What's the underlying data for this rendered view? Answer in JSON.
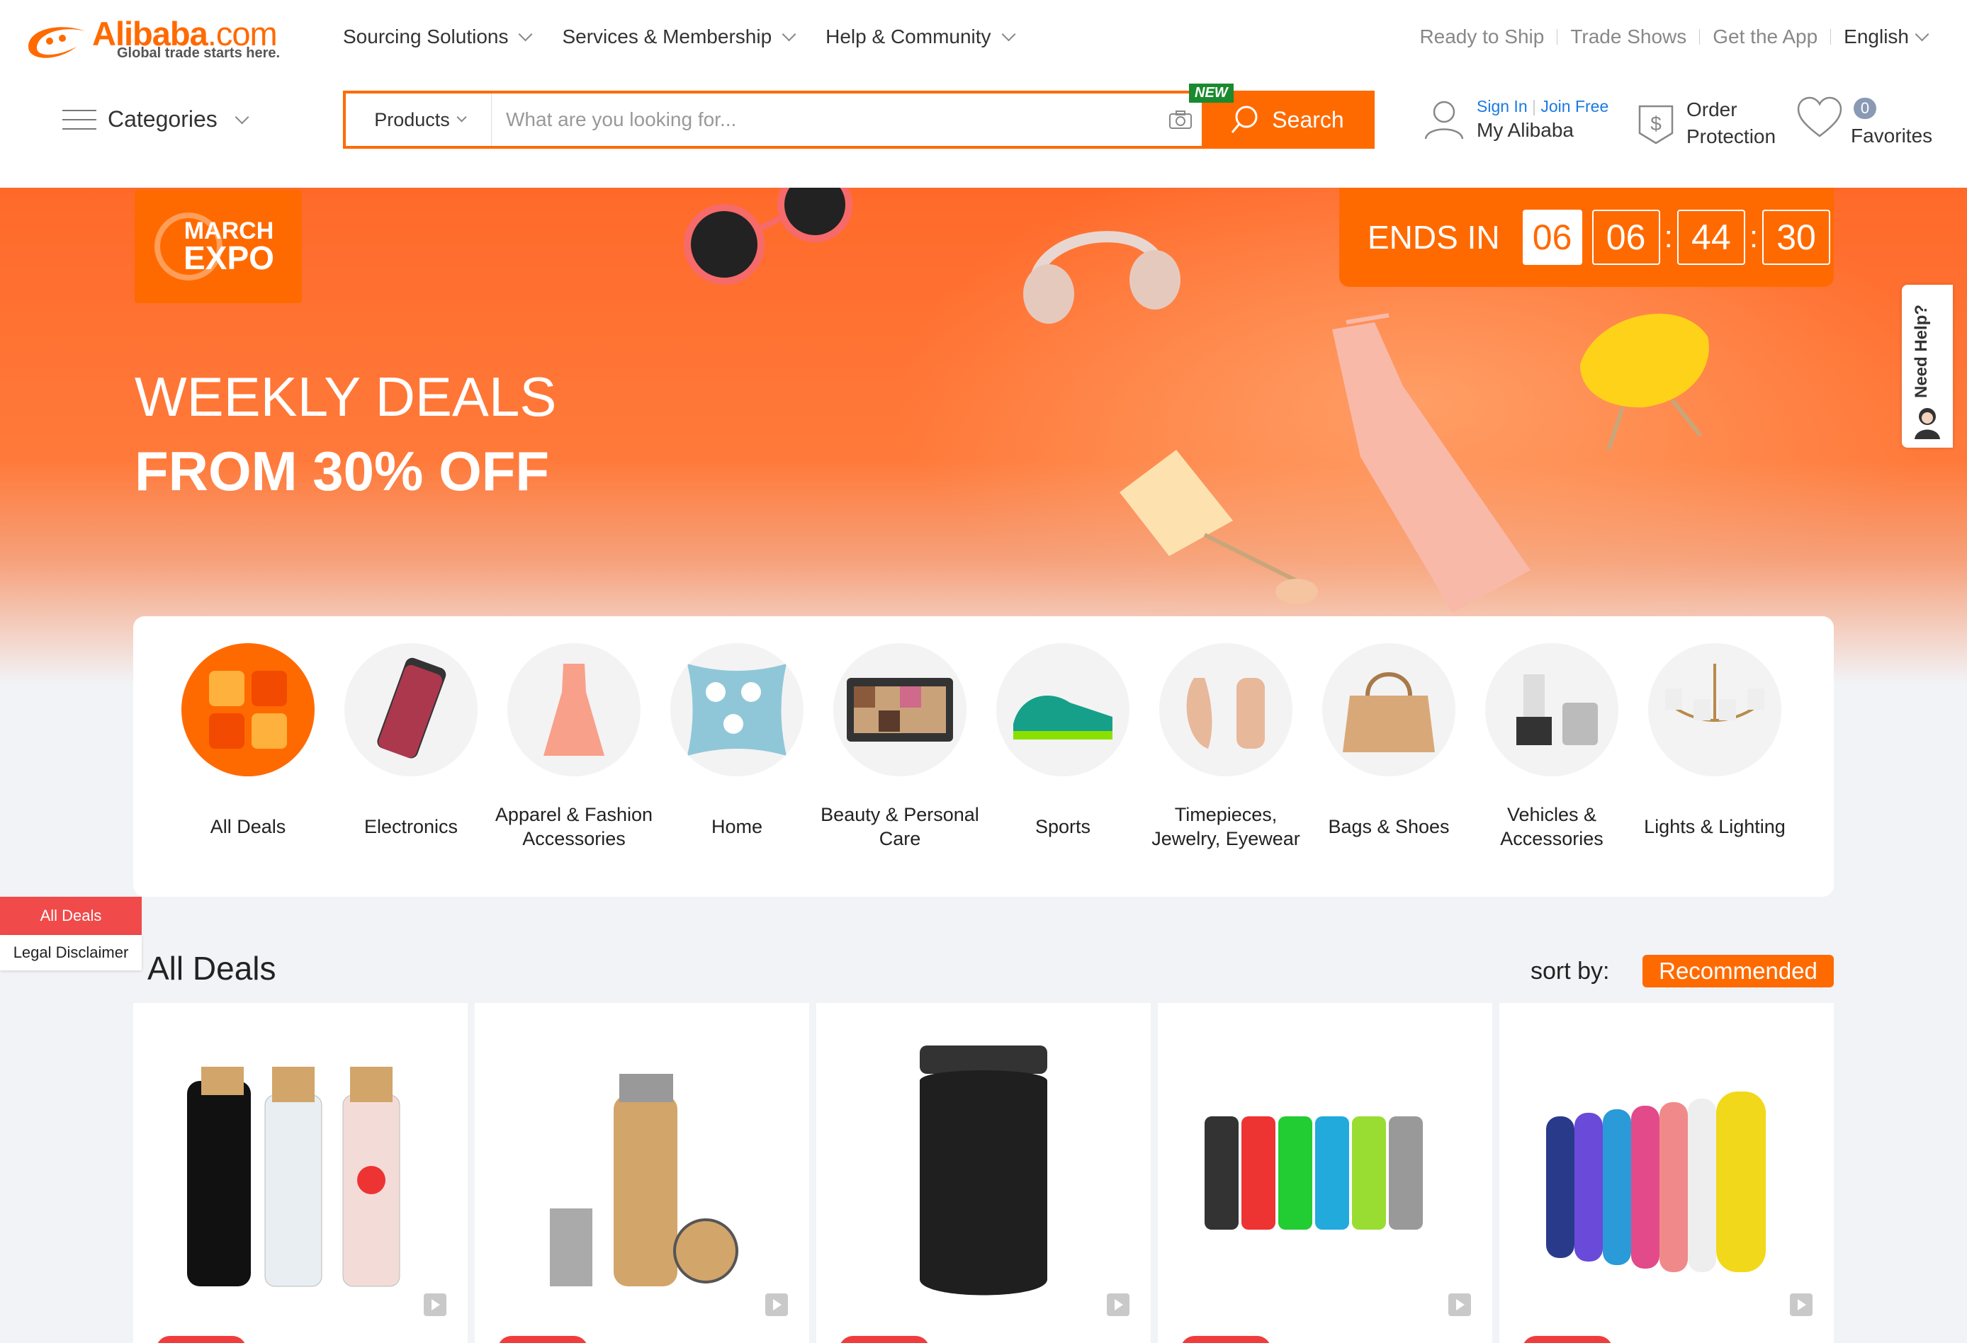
{
  "header": {
    "logo": {
      "name": "Alibaba",
      "suffix": ".com",
      "tagline": "Global trade starts here."
    },
    "nav": [
      {
        "label": "Sourcing Solutions"
      },
      {
        "label": "Services & Membership"
      },
      {
        "label": "Help & Community"
      }
    ],
    "links": [
      "Ready to Ship",
      "Trade Shows",
      "Get the App"
    ],
    "language": "English",
    "categories_label": "Categories",
    "search": {
      "scope": "Products",
      "placeholder": "What are you looking for...",
      "button": "Search",
      "new_badge": "NEW"
    },
    "account": {
      "sign_in": "Sign In",
      "join": "Join Free",
      "label": "My Alibaba"
    },
    "order": {
      "line1": "Order",
      "line2": "Protection"
    },
    "favorites": {
      "count": "0",
      "label": "Favorites"
    }
  },
  "banner": {
    "expo_line1": "MARCH",
    "expo_line2": "EXPO",
    "headline": "WEEKLY DEALS",
    "subheadline": "FROM 30% OFF",
    "timer": {
      "label": "ENDS IN",
      "days": "06",
      "hours": "06",
      "minutes": "44",
      "seconds": "30"
    }
  },
  "need_help": "Need Help?",
  "categories": [
    {
      "name": "All Deals",
      "icon": "all-deals-icon",
      "active": true
    },
    {
      "name": "Electronics",
      "icon": "phone-case-icon"
    },
    {
      "name": "Apparel & Fashion Accessories",
      "icon": "dress-icon"
    },
    {
      "name": "Home",
      "icon": "pillow-icon"
    },
    {
      "name": "Beauty & Personal Care",
      "icon": "eyeshadow-palette-icon"
    },
    {
      "name": "Sports",
      "icon": "sneaker-icon"
    },
    {
      "name": "Timepieces, Jewelry, Eyewear",
      "icon": "earrings-icon"
    },
    {
      "name": "Bags & Shoes",
      "icon": "handbag-icon"
    },
    {
      "name": "Vehicles & Accessories",
      "icon": "headlight-bulb-icon"
    },
    {
      "name": "Lights & Lighting",
      "icon": "chandelier-icon"
    }
  ],
  "side_tabs": {
    "active": "All Deals",
    "legal": "Legal Disclaimer"
  },
  "deals": {
    "title": "All Deals",
    "sort_label": "sort by:",
    "sort_value": "Recommended",
    "products": [
      {
        "image": "glass-bottles-image"
      },
      {
        "image": "bamboo-bottle-image"
      },
      {
        "image": "black-tumbler-image"
      },
      {
        "image": "sports-bottles-image"
      },
      {
        "image": "colorful-bottles-image"
      }
    ]
  },
  "colors": {
    "brand": "#ff6a00",
    "link": "#1a7ae0",
    "discount": "#f03c3c",
    "new_badge": "#1a8a2e"
  }
}
